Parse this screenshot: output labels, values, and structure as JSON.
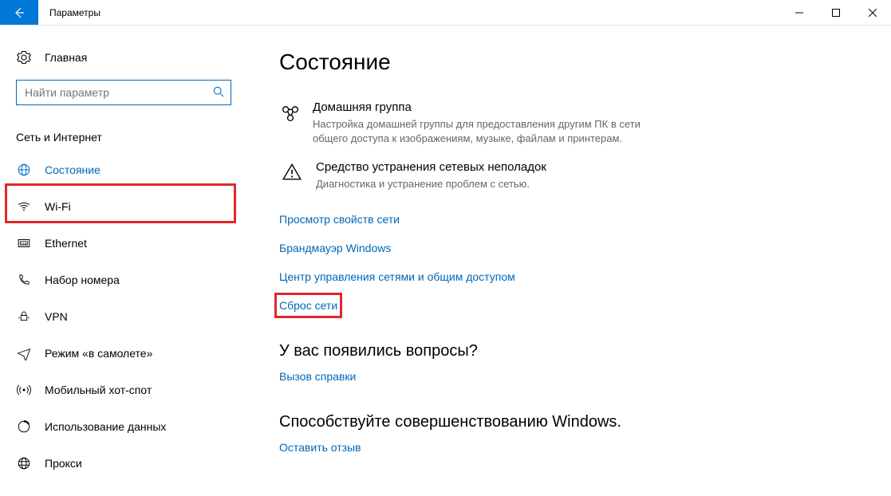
{
  "titlebar": {
    "title": "Параметры"
  },
  "sidebar": {
    "home_label": "Главная",
    "search_placeholder": "Найти параметр",
    "section_header": "Сеть и Интернет",
    "items": [
      {
        "label": "Состояние"
      },
      {
        "label": "Wi-Fi"
      },
      {
        "label": "Ethernet"
      },
      {
        "label": "Набор номера"
      },
      {
        "label": "VPN"
      },
      {
        "label": "Режим «в самолете»"
      },
      {
        "label": "Мобильный хот-спот"
      },
      {
        "label": "Использование данных"
      },
      {
        "label": "Прокси"
      }
    ]
  },
  "main": {
    "heading": "Состояние",
    "homegroup": {
      "title": "Домашняя группа",
      "desc": "Настройка домашней группы для предоставления другим ПК в сети общего доступа к изображениям, музыке, файлам и принтерам."
    },
    "troubleshoot": {
      "title": "Средство устранения сетевых неполадок",
      "desc": "Диагностика и устранение проблем с сетью."
    },
    "links": {
      "view_props": "Просмотр свойств сети",
      "firewall": "Брандмауэр Windows",
      "sharing_center": "Центр управления сетями и общим доступом",
      "network_reset": "Сброс сети"
    },
    "questions": {
      "heading": "У вас появились вопросы?",
      "help": "Вызов справки"
    },
    "feedback": {
      "heading": "Способствуйте совершенствованию Windows.",
      "leave": "Оставить отзыв"
    }
  }
}
